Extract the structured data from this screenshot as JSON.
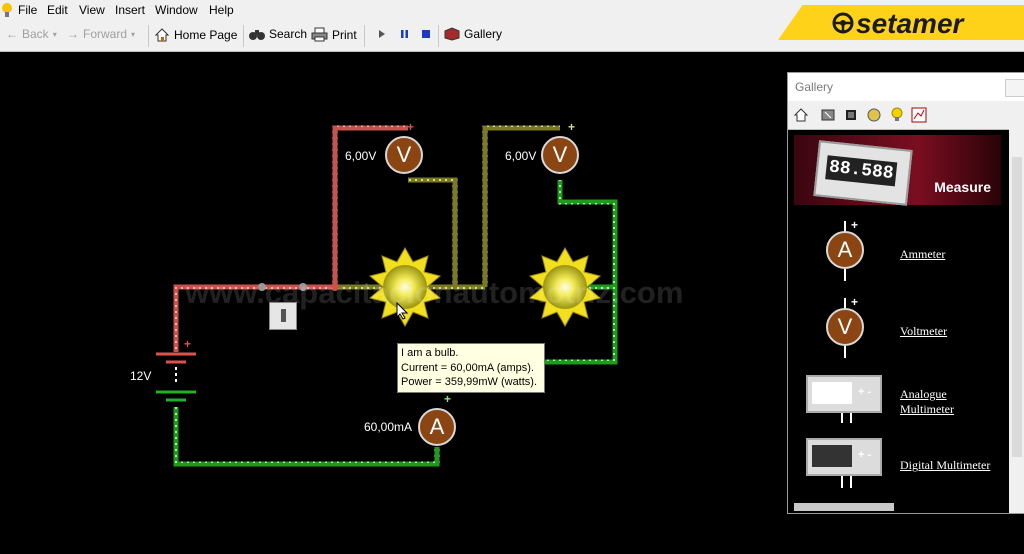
{
  "menu": [
    "File",
    "Edit",
    "View",
    "Insert",
    "Window",
    "Help"
  ],
  "toolbar": {
    "back": "Back",
    "forward": "Forward",
    "home": "Home Page",
    "search": "Search",
    "print": "Print",
    "gallery": "Gallery"
  },
  "brand": {
    "name": "setamer",
    "color": "#ffd21a"
  },
  "circuit": {
    "voltmeter1_reading": "6,00V",
    "voltmeter2_reading": "6,00V",
    "ammeter_reading": "60,00mA",
    "battery_label": "12V",
    "plus": "+",
    "meter_v": "V",
    "meter_a": "A",
    "watermark": "www.capacitacionautomotriz.com",
    "colors": {
      "positive": "#d9534f",
      "neutral": "#8a8a2a",
      "negative": "#22b022"
    }
  },
  "tooltip": {
    "line1": "I am a bulb.",
    "line2": "Current = 60,00mA (amps).",
    "line3": "Power = 359,99mW (watts)."
  },
  "gallery": {
    "title": "Gallery",
    "header_title": "Measure",
    "header_display": "88.588",
    "items": [
      {
        "label": "Ammeter",
        "symbol": "A"
      },
      {
        "label": "Voltmeter",
        "symbol": "V"
      },
      {
        "label_line1": "Analogue",
        "label_line2": "Multimeter"
      },
      {
        "label": "Digital Multimeter"
      }
    ]
  }
}
